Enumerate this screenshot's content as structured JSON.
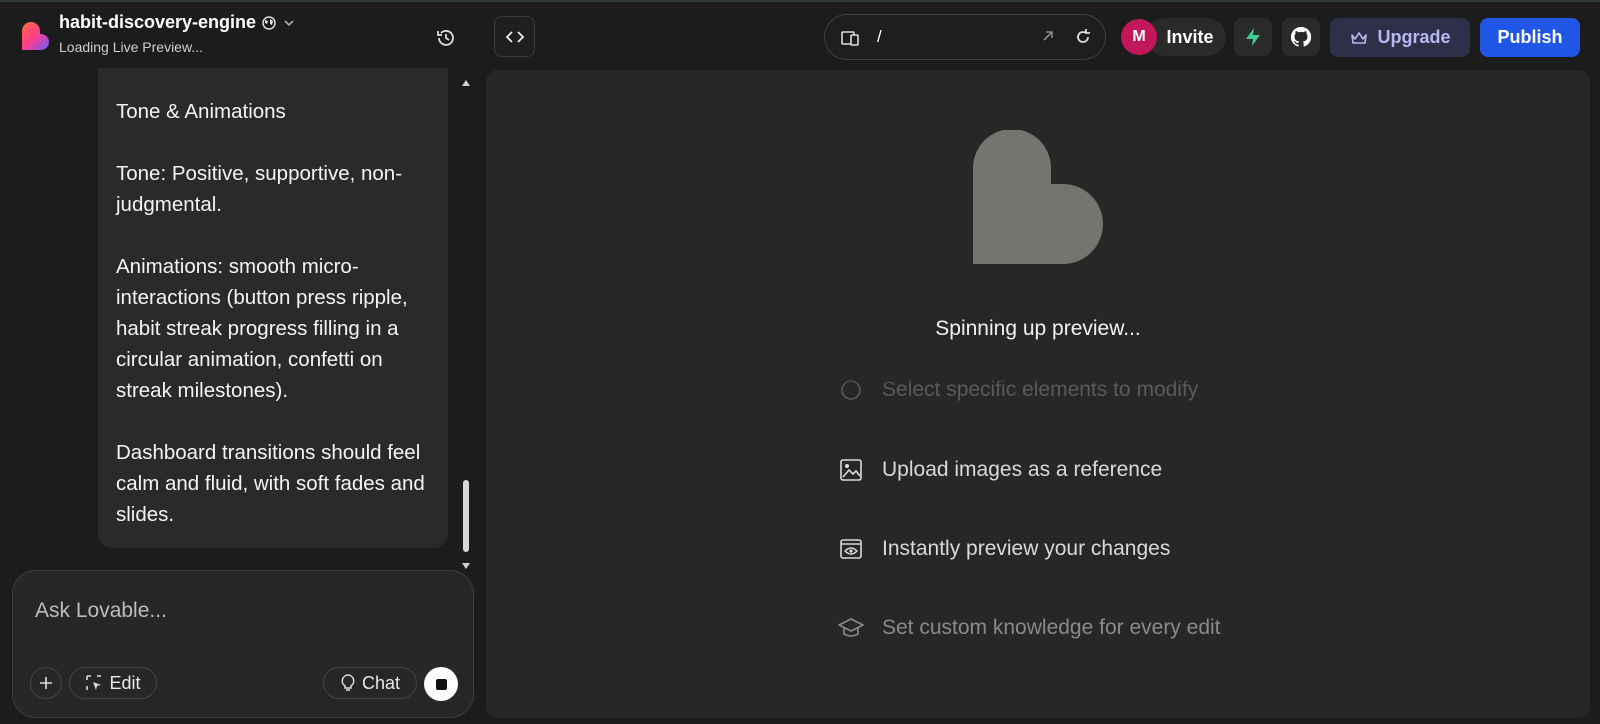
{
  "project": {
    "name": "habit-discovery-engine",
    "status": "Loading Live Preview..."
  },
  "url_bar": {
    "path": "/"
  },
  "header": {
    "avatar_initial": "M",
    "invite_label": "Invite",
    "upgrade_label": "Upgrade",
    "publish_label": "Publish"
  },
  "chat": {
    "message_paragraphs": [
      "Tone & Animations",
      "Tone: Positive, supportive, non-judgmental.",
      "Animations: smooth micro-interactions (button press ripple, habit streak progress filling in a circular animation, confetti on streak milestones).",
      "Dashboard transitions should feel calm and fluid, with soft fades and slides."
    ],
    "input_placeholder": "Ask Lovable...",
    "edit_label": "Edit",
    "chat_label": "Chat"
  },
  "preview": {
    "status_text": "Spinning up preview...",
    "tips": [
      {
        "icon": "cursor-select-icon",
        "text": "Select specific elements to modify"
      },
      {
        "icon": "image-icon",
        "text": "Upload images as a reference"
      },
      {
        "icon": "eye-window-icon",
        "text": "Instantly preview your changes"
      },
      {
        "icon": "graduation-cap-icon",
        "text": "Set custom knowledge for every edit"
      }
    ]
  },
  "colors": {
    "background": "#1c1c1c",
    "panel": "#272727",
    "publish": "#1f56e6",
    "upgrade_bg": "#2e2f48",
    "upgrade_text": "#b7b9f0",
    "avatar": "#c2185b",
    "heart": "#757570"
  }
}
